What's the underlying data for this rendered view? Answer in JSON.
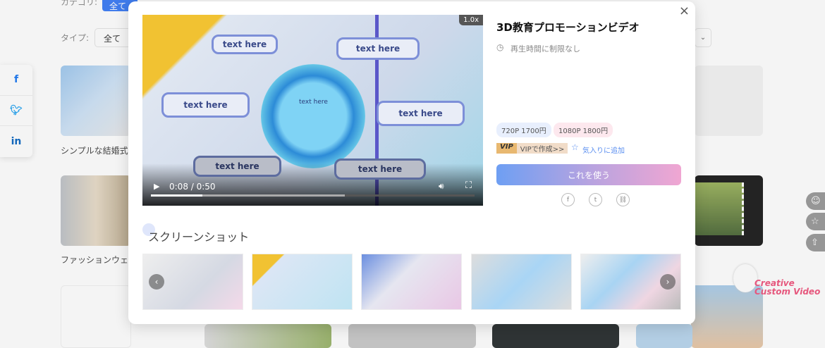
{
  "background": {
    "category_label": "カテゴリ:",
    "category_selected": "全て",
    "type_label": "タイプ:",
    "type_selected": "全て",
    "captions": [
      "シンプルな結婚式の",
      "ファッションウェデ"
    ],
    "social": [
      "f",
      "twitter",
      "in"
    ],
    "mascot_text": "Creative Custom Video"
  },
  "modal": {
    "title": "3D教育プロモーションビデオ",
    "duration": "再生時間に制限なし",
    "video": {
      "speed": "1.0x",
      "time": "0:08 / 0:50",
      "progress": 0.16,
      "buffered": 0.6,
      "labels": [
        "text here",
        "text here",
        "text here",
        "text here",
        "text here",
        "text here",
        "text here"
      ]
    },
    "prices": [
      {
        "label": "720P  1700円",
        "color": "#e8effd"
      },
      {
        "label": "1080P  1800円",
        "color": "#fde8ee"
      }
    ],
    "vip_badge": "VIP",
    "vip_link": "VIPで作成>>",
    "favorite": "気入りに追加",
    "use_button": "これを使う",
    "screenshots_title": "スクリーンショット",
    "close": "×"
  },
  "colors": {
    "accent": "#3b7cf6"
  }
}
